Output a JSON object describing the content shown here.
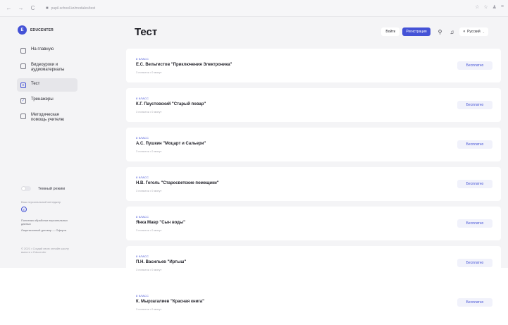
{
  "browser": {
    "back": "←",
    "forward": "→",
    "reload": "C",
    "url": "pupil.school.kz/modules/test",
    "actions": [
      "☆",
      "☆",
      "♟",
      "≡"
    ]
  },
  "sidebar": {
    "logo_mark": "E",
    "logo_text": "EDUCENTER",
    "items": [
      {
        "label": "На главную",
        "icon": "home-icon",
        "active": false
      },
      {
        "label": "Видеоуроки и аудиоматериалы",
        "icon": "video-icon",
        "active": false
      },
      {
        "label": "Тест",
        "icon": "test-icon",
        "active": true
      },
      {
        "label": "Тренажеры",
        "icon": "trainer-icon",
        "active": false
      },
      {
        "label": "Методическая помощь учителю",
        "icon": "teacher-help-icon",
        "active": false
      }
    ],
    "theme_label": "Темный режим",
    "manager_text": "Ваш персональный менеджер",
    "links": [
      "Политика обработки персональных данных",
      "Лицензионный договор — Оферта"
    ],
    "copyright": "© 2021 • Создай свою онлайн школу вместе с Educenter"
  },
  "header": {
    "title": "Тест",
    "login": "Войти",
    "register": "Регистрация",
    "language": "Русский"
  },
  "cards": [
    {
      "grade": "8 КЛАСС",
      "title": "Е.С. Вельтистов \"Приключения Электроника\"",
      "meta": "3 попыток • 0 минут",
      "price": "Бесплатно"
    },
    {
      "grade": "8 КЛАСС",
      "title": "К.Г. Паустовский \"Старый повар\"",
      "meta": "3 попыток • 0 минут",
      "price": "Бесплатно"
    },
    {
      "grade": "8 КЛАСС",
      "title": "А.С. Пушкин \"Моцарт и Сальери\"",
      "meta": "3 попыток • 0 минут",
      "price": "Бесплатно"
    },
    {
      "grade": "8 КЛАСС",
      "title": "Н.В. Гоголь \"Старосветские помещики\"",
      "meta": "3 попыток • 0 минут",
      "price": "Бесплатно"
    },
    {
      "grade": "8 КЛАСС",
      "title": "Янка Мавр \"Сын воды\"",
      "meta": "3 попыток • 0 минут",
      "price": "Бесплатно"
    },
    {
      "grade": "8 КЛАСС",
      "title": "П.Н. Васильев \"Иртыш\"",
      "meta": "3 попыток • 0 минут",
      "price": "Бесплатно"
    },
    {
      "grade": "8 КЛАСС",
      "title": "К. Мырзагалиев \"Красная книга\"",
      "meta": "3 попыток • 0 минут",
      "price": "Бесплатно"
    }
  ]
}
